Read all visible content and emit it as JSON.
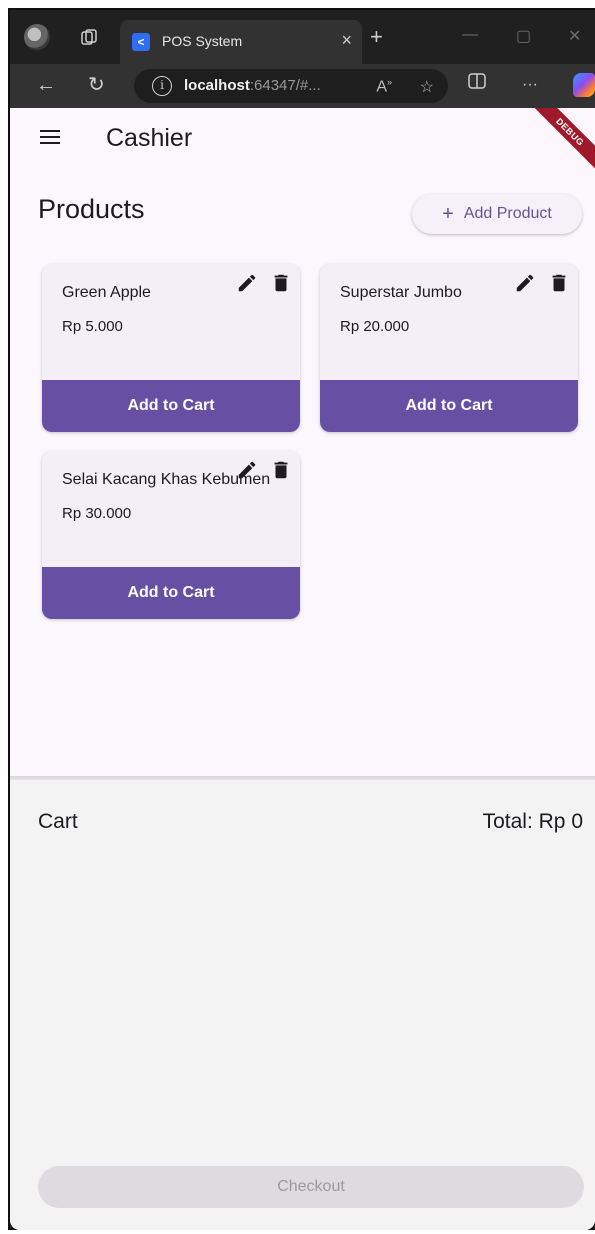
{
  "browser": {
    "tab_title": "POS System",
    "tab_close": "×",
    "new_tab": "+",
    "url_host": "localhost",
    "url_rest": ":64347/#...",
    "minimize": "—",
    "maximize": "▢",
    "close": "✕",
    "more": "···",
    "icons": [
      "profile-avatar",
      "workspaces-icon",
      "flutter-favicon",
      "back-icon",
      "refresh-icon",
      "site-info-icon",
      "read-aloud-icon",
      "favorite-star-icon",
      "split-screen-icon",
      "more-icon",
      "copilot-icon"
    ]
  },
  "app": {
    "title": "Cashier",
    "debug_banner": "DEBUG",
    "accent": "#6750a4"
  },
  "products": {
    "heading": "Products",
    "add_label": "Add Product",
    "items": [
      {
        "name": "Green Apple",
        "price": "Rp 5.000",
        "cart_label": "Add to Cart"
      },
      {
        "name": "Superstar Jumbo",
        "price": "Rp 20.000",
        "cart_label": "Add to Cart"
      },
      {
        "name": "Selai Kacang Khas Kebumen",
        "price": "Rp 30.000",
        "cart_label": "Add to Cart"
      }
    ]
  },
  "cart": {
    "heading": "Cart",
    "total": "Total: Rp 0",
    "checkout_label": "Checkout"
  }
}
